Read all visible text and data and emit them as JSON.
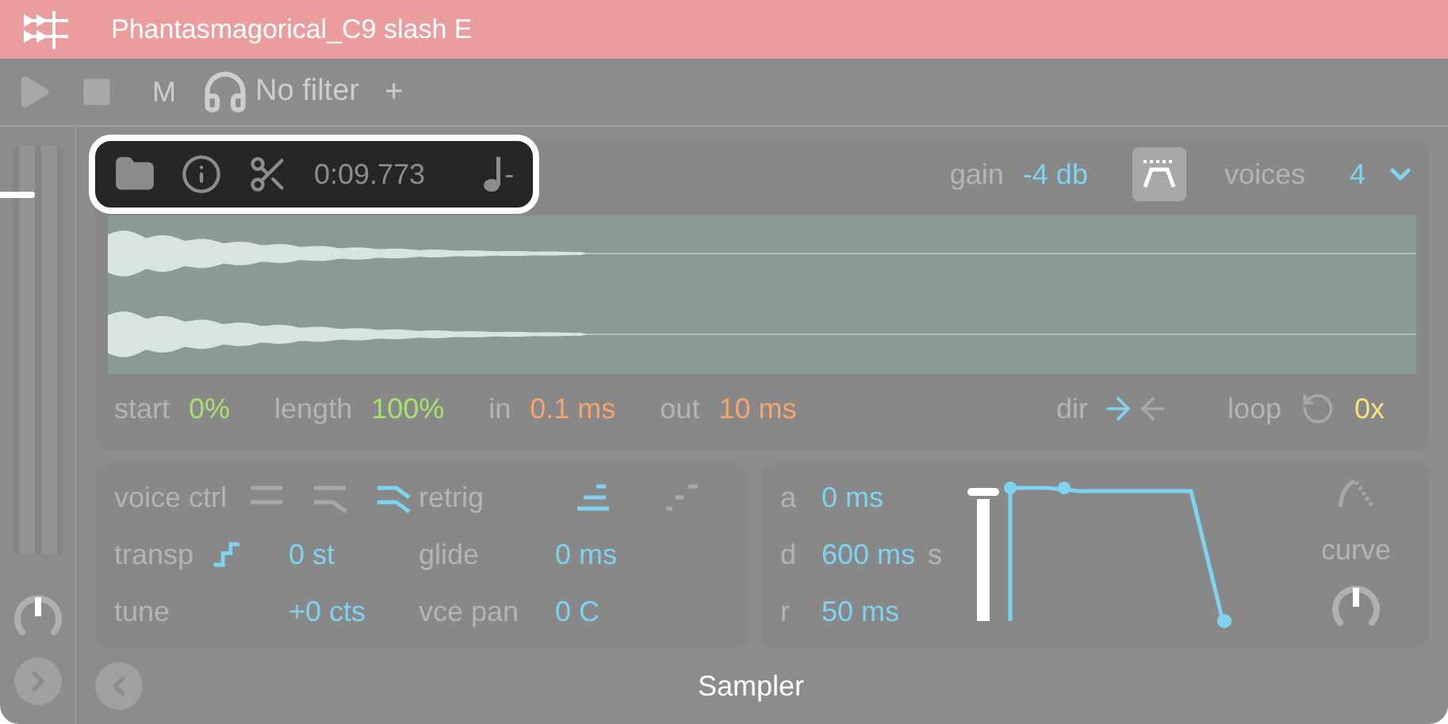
{
  "title_bar": {
    "title": "Phantasmagorical_C9 slash E"
  },
  "toolbar": {
    "mute_label": "M",
    "filter": "No filter",
    "add": "+"
  },
  "volume_fader": {
    "level": 0.9
  },
  "sample_bar": {
    "time": "0:09.773",
    "note_suffix": "-"
  },
  "gain": {
    "label": "gain",
    "value": "-4 db"
  },
  "envelope_toggle": {
    "on": true
  },
  "voices": {
    "label": "voices",
    "value": "4"
  },
  "sample_params": [
    {
      "label": "start",
      "value": "0%",
      "color": "#a8e070"
    },
    {
      "label": "length",
      "value": "100%",
      "color": "#a8e070"
    },
    {
      "label": "in",
      "value": "0.1 ms",
      "color": "#f5a46e"
    },
    {
      "label": "out",
      "value": "10 ms",
      "color": "#f5a46e"
    }
  ],
  "dir": {
    "label": "dir",
    "options": [
      {
        "kind": "forward",
        "selected": true
      },
      {
        "kind": "backward",
        "selected": false
      }
    ]
  },
  "loop": {
    "label": "loop",
    "value": "0x"
  },
  "voice_ctrl": {
    "label": "voice ctrl",
    "modes": [
      {
        "kind": "flat",
        "selected": false
      },
      {
        "kind": "bend",
        "selected": false
      },
      {
        "kind": "glide",
        "selected": true
      }
    ]
  },
  "retrig": {
    "label": "retrig",
    "modes": [
      {
        "kind": "solid",
        "selected": true
      },
      {
        "kind": "dashed",
        "selected": false
      }
    ]
  },
  "params": [
    {
      "label": "transp",
      "value": "0 st",
      "kind": "stepped"
    },
    {
      "label": "glide",
      "value": "0 ms",
      "kind": "plain"
    },
    {
      "label": "tune",
      "value": "+0 cts",
      "kind": "plain"
    },
    {
      "label": "vce pan",
      "value": "0 C",
      "kind": "plain"
    }
  ],
  "envelope": {
    "rows": [
      {
        "label": "a",
        "value": "0 ms"
      },
      {
        "label": "d",
        "value": "600 ms",
        "suffix": "s"
      },
      {
        "label": "r",
        "value": "50 ms"
      }
    ],
    "sustain": {
      "level": 1
    },
    "curve_label": "curve"
  },
  "footer": {
    "title": "Sampler"
  }
}
